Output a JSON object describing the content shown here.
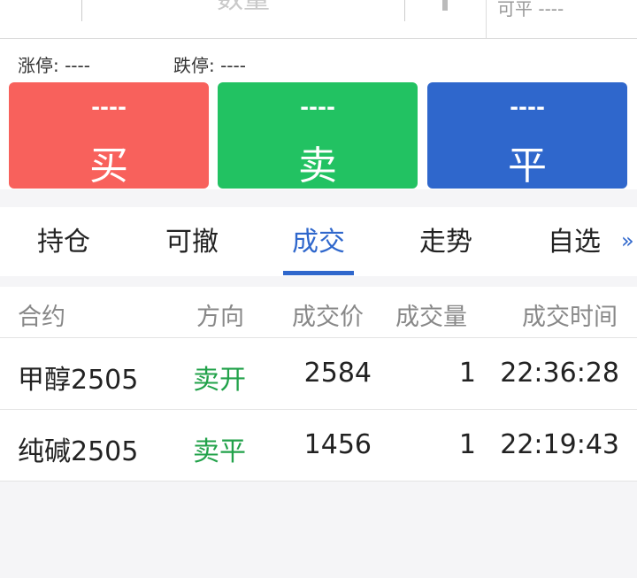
{
  "top": {
    "quantity_placeholder": "数量",
    "closable_label": "可平 ----"
  },
  "limits": {
    "limit_up": "涨停: ----",
    "limit_down": "跌停: ----"
  },
  "actions": {
    "buy": {
      "price": "----",
      "label": "买"
    },
    "sell": {
      "price": "----",
      "label": "卖"
    },
    "close": {
      "price": "----",
      "label": "平"
    }
  },
  "tabs": [
    {
      "label": "持仓"
    },
    {
      "label": "可撤"
    },
    {
      "label": "成交"
    },
    {
      "label": "走势"
    },
    {
      "label": "自选"
    }
  ],
  "tab_more": "»",
  "table": {
    "headers": [
      "合约",
      "方向",
      "成交价",
      "成交量",
      "成交时间"
    ],
    "rows": [
      [
        "甲醇2505",
        "卖开",
        "2584",
        "1",
        "22:36:28"
      ],
      [
        "纯碱2505",
        "卖平",
        "1456",
        "1",
        "22:19:43"
      ]
    ]
  },
  "colors": {
    "buy": "#f8615c",
    "sell": "#22c262",
    "close": "#2f67cc",
    "active_tab": "#2f67cc",
    "direction_text": "#22a24a"
  },
  "icons": {
    "more_tabs": "double-chevron-right-icon"
  }
}
